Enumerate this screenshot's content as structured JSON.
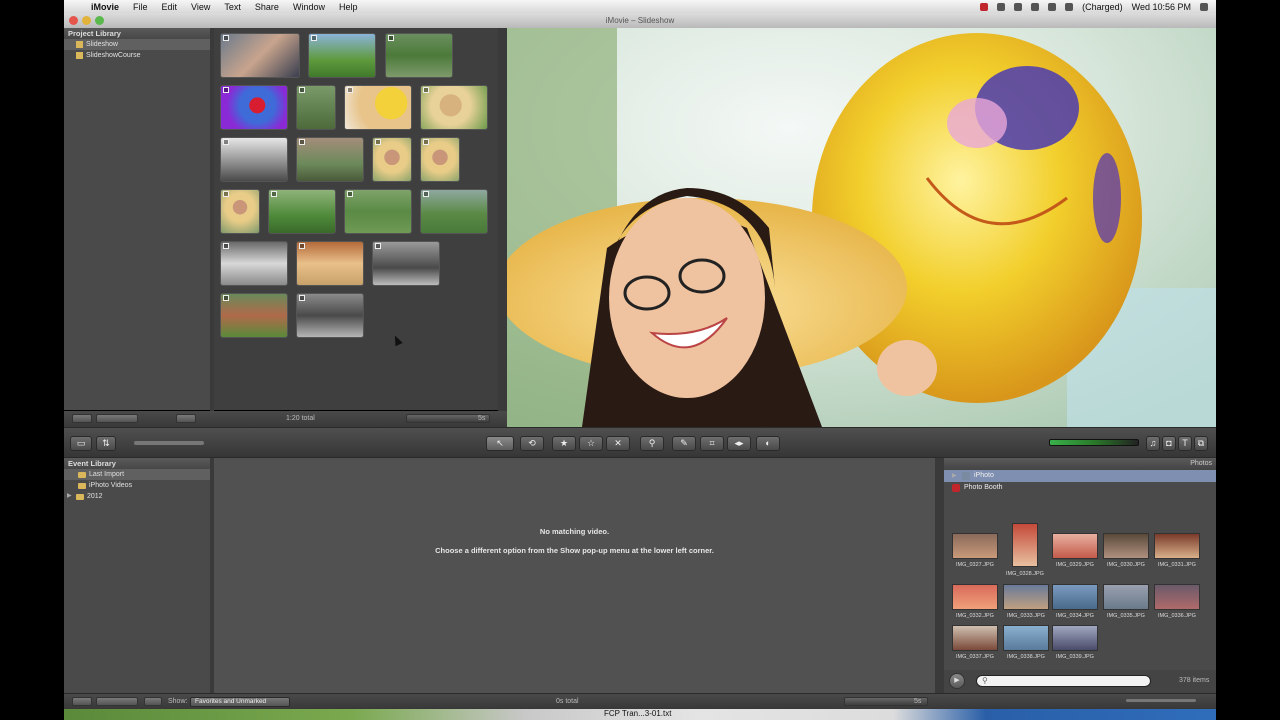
{
  "menubar": {
    "app_name": "iMovie",
    "items": [
      "File",
      "Edit",
      "View",
      "Text",
      "Share",
      "Window",
      "Help"
    ],
    "battery": "(Charged)",
    "clock": "Wed 10:56 PM"
  },
  "window": {
    "title": "iMovie – Slideshow"
  },
  "project_library": {
    "header": "Project Library",
    "projects": [
      {
        "label": "Slideshow",
        "selected": true
      },
      {
        "label": "SlideshowCourse",
        "selected": false
      }
    ],
    "total": "1:20 total",
    "zoom_label": "5s"
  },
  "event_library": {
    "header": "Event Library",
    "items": [
      {
        "label": "Last Import",
        "selected": true
      },
      {
        "label": "iPhoto Videos",
        "selected": false
      },
      {
        "label": "2012",
        "selected": false
      }
    ]
  },
  "event_browser": {
    "message_title": "No matching video.",
    "message_body": "Choose a different option from the Show pop-up menu at the lower left corner.",
    "total": "0s total",
    "show_label": "Show:",
    "show_value": "Favorites and Unmarked",
    "zoom_label": "5s"
  },
  "photos_browser": {
    "header": "Photos",
    "sources": [
      {
        "label": "iPhoto",
        "selected": true
      },
      {
        "label": "Photo Booth",
        "selected": false
      }
    ],
    "photos": [
      "IMG_0327.JPG",
      "IMG_0328.JPG",
      "IMG_0329.JPG",
      "IMG_0330.JPG",
      "IMG_0331.JPG",
      "IMG_0332.JPG",
      "IMG_0333.JPG",
      "IMG_0334.JPG",
      "IMG_0335.JPG",
      "IMG_0336.JPG",
      "IMG_0337.JPG",
      "IMG_0338.JPG",
      "IMG_0339.JPG"
    ],
    "count": "378 items"
  },
  "desktop": {
    "file_label": "FCP Tran...3-01.txt"
  },
  "colors": {
    "pane_bg": "#4a4a4a",
    "selection": "#7f8fb2",
    "accent_yellow": "#f2c92b"
  }
}
